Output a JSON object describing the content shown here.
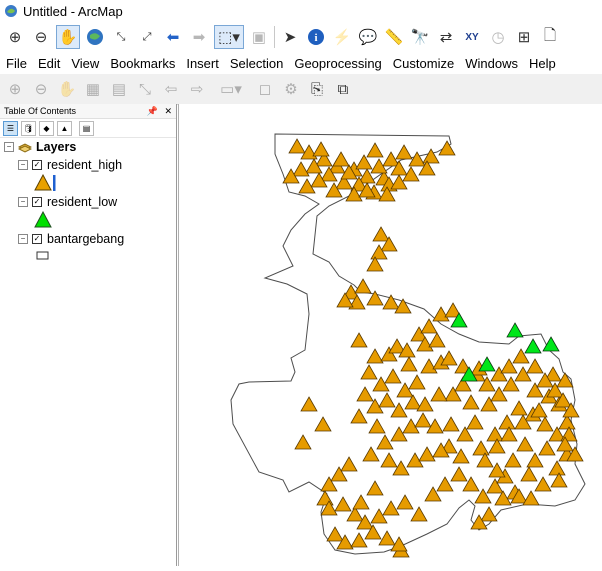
{
  "window": {
    "title": "Untitled - ArcMap"
  },
  "menu": [
    "File",
    "Edit",
    "View",
    "Bookmarks",
    "Insert",
    "Selection",
    "Geoprocessing",
    "Customize",
    "Windows",
    "Help"
  ],
  "toolbar1": [
    "zoom-in-icon",
    "zoom-out-icon",
    "pan-icon",
    "full-extent-icon",
    "fixed-zoom-in-icon",
    "fixed-zoom-out-icon",
    "back-icon",
    "forward-icon",
    "select-features-icon",
    "clear-selection-icon",
    "select-elements-icon",
    "identify-icon",
    "hyperlink-icon",
    "html-popup-icon",
    "measure-icon",
    "find-icon",
    "find-route-icon",
    "go-to-xy-icon",
    "time-slider-icon",
    "magnifier-icon",
    "page-icon"
  ],
  "toolbar1_labels": {
    "go_to_xy": "XY"
  },
  "toc": {
    "header": "Table Of Contents",
    "root_label": "Layers",
    "layers": [
      {
        "name": "resident_high",
        "symbol": "triangle",
        "color": "#e8a100"
      },
      {
        "name": "resident_low",
        "symbol": "triangle",
        "color": "#00e000"
      },
      {
        "name": "bantargebang",
        "symbol": "polygon",
        "color": "#ffffff"
      }
    ]
  },
  "map": {
    "high_color": "#e69b00",
    "low_color": "#00e61a",
    "outline_color": "#4d4d4d"
  }
}
